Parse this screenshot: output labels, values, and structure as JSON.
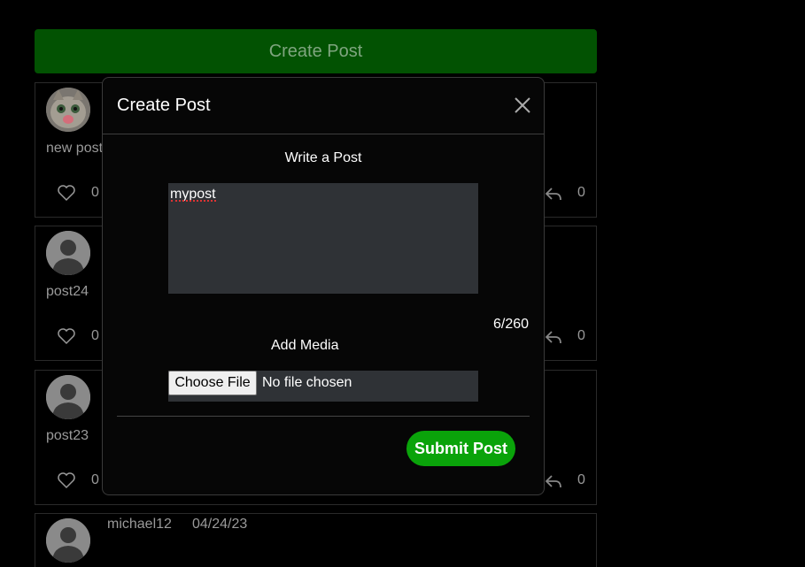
{
  "header": {
    "create_post_label": "Create Post"
  },
  "posts": [
    {
      "text": "new post",
      "likes": "0",
      "shares": "0"
    },
    {
      "text": "post24",
      "likes": "0",
      "shares": "0"
    },
    {
      "text": "post23",
      "likes": "0",
      "shares": "0"
    },
    {
      "username": "michael12",
      "date": "04/24/23"
    }
  ],
  "modal": {
    "title": "Create Post",
    "write_label": "Write a Post",
    "post_text": "mypost",
    "char_count": "6/260",
    "media_label": "Add Media",
    "choose_file_label": "Choose File",
    "file_status": "No file chosen",
    "submit_label": "Submit Post"
  },
  "colors": {
    "accent": "#0aa30a",
    "header_bar": "#025202"
  }
}
